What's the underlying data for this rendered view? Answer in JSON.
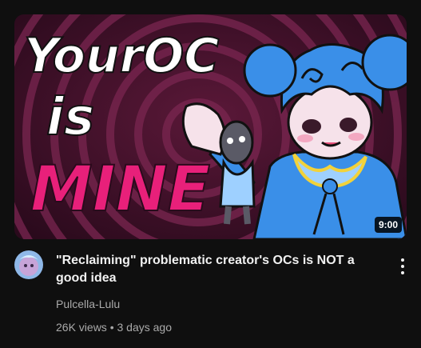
{
  "video": {
    "duration": "9:00",
    "title": "\"Reclaiming\" problematic creator's OCs is NOT a good idea",
    "channel": "Pulcella-Lulu",
    "views": "26K views",
    "separator": "•",
    "age": "3 days ago"
  },
  "thumbnail": {
    "art_text_line1": "YourOC",
    "art_text_line2": "is",
    "art_text_line3": "MINE"
  },
  "icons": {
    "more": "more-vert-icon"
  },
  "colors": {
    "background": "#0f0f0f",
    "text_primary": "#f1f1f1",
    "text_secondary": "#aaaaaa",
    "thumb_bg": "#3a1024",
    "thumb_accent": "#e8207a",
    "character_blue": "#3a8fe8"
  }
}
